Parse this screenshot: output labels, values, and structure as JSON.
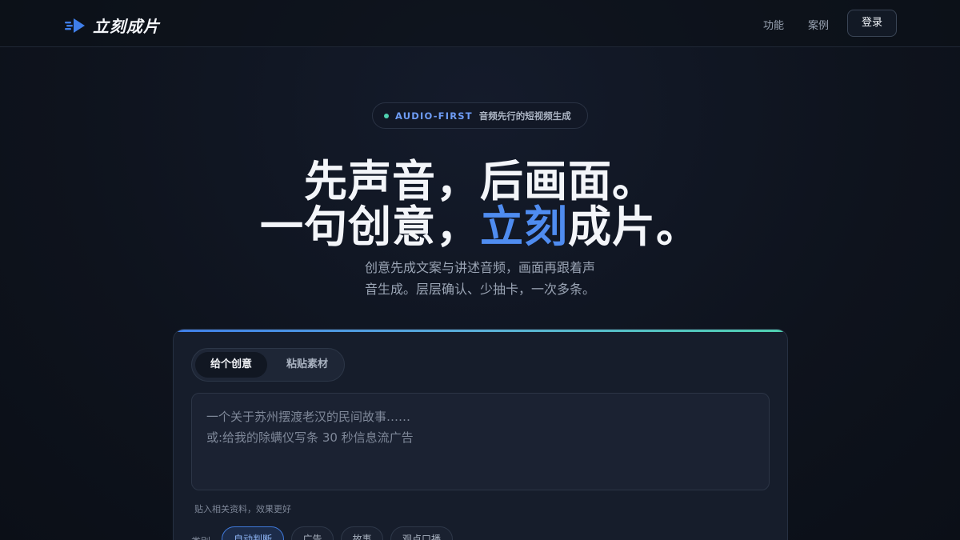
{
  "header": {
    "brand": "立刻成片",
    "nav": [
      "功能",
      "案例"
    ],
    "login": "登录"
  },
  "hero": {
    "badge_tag": "AUDIO-FIRST",
    "badge_text": "音频先行的短视频生成",
    "line1": "先声音，后画面。",
    "line2_pre": "一句创意，",
    "line2_accent": "立刻",
    "line2_post": "成片。",
    "sub1": "创意先成文案与讲述音频，画面再跟着声",
    "sub2": "音生成。层层确认、少抽卡，一次多条。"
  },
  "composer": {
    "tabs": [
      "给个创意",
      "粘贴素材"
    ],
    "active_tab": 0,
    "placeholder_line1": "一个关于苏州摆渡老汉的民间故事……",
    "placeholder_line2": "或:给我的除螨仪写条 30 秒信息流广告",
    "hint": "贴入相关资料，效果更好",
    "category_label": "类别",
    "categories": [
      "自动判断",
      "广告",
      "故事",
      "观点口播"
    ],
    "active_category": 0
  },
  "colors": {
    "accent": "#4f8cf0",
    "badge_dot": "#4fd1b0",
    "background": "#0e131d"
  }
}
